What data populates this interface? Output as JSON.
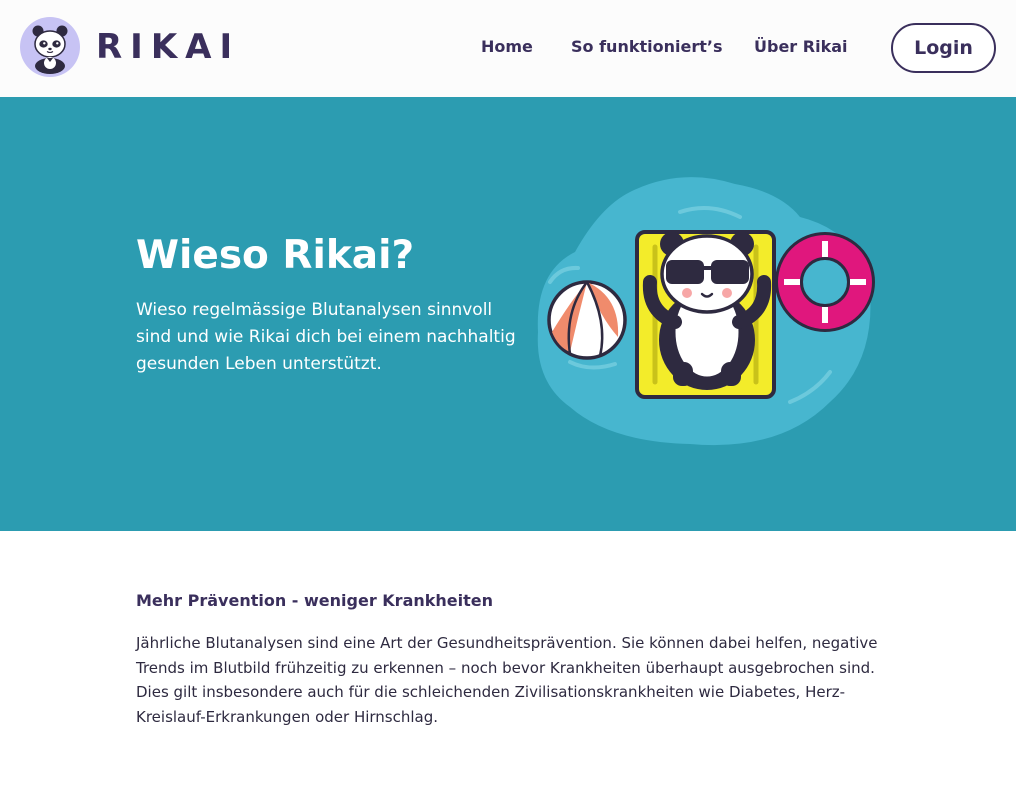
{
  "header": {
    "brand": "RIKAI",
    "nav": [
      "Home",
      "So funktioniert’s",
      "Über Rikai"
    ],
    "login_label": "Login"
  },
  "hero": {
    "title": "Wieso Rikai?",
    "subtitle": "Wieso regelmässige Blutanalysen sinnvoll sind und wie Rikai dich bei einem nachhaltig gesunden Leben unterstützt.",
    "background_color": "#2c9cb1"
  },
  "content": {
    "heading": "Mehr Prävention - weniger Krankheiten",
    "body": "Jährliche Blutanalysen sind eine Art der Gesundheitsprävention. Sie können dabei helfen, negative Trends im Blutbild frühzeitig zu erkennen – noch bevor Krankheiten überhaupt ausgebrochen sind. Dies gilt insbesondere auch für die schleichenden Zivilisationskrankheiten wie Diabetes, Herz-Kreislauf-Erkrankungen oder Hirnschlag."
  },
  "icons": {
    "logo": "panda-logo-icon",
    "hero_illustration": "panda-on-pool-float-illustration"
  },
  "colors": {
    "brand": "#3a2f5c",
    "hero_bg": "#2c9cb1",
    "pool": "#47b6cf",
    "float": "#f3ec2a",
    "lifebuoy": "#e0177d",
    "ball": "#f08b6c"
  }
}
